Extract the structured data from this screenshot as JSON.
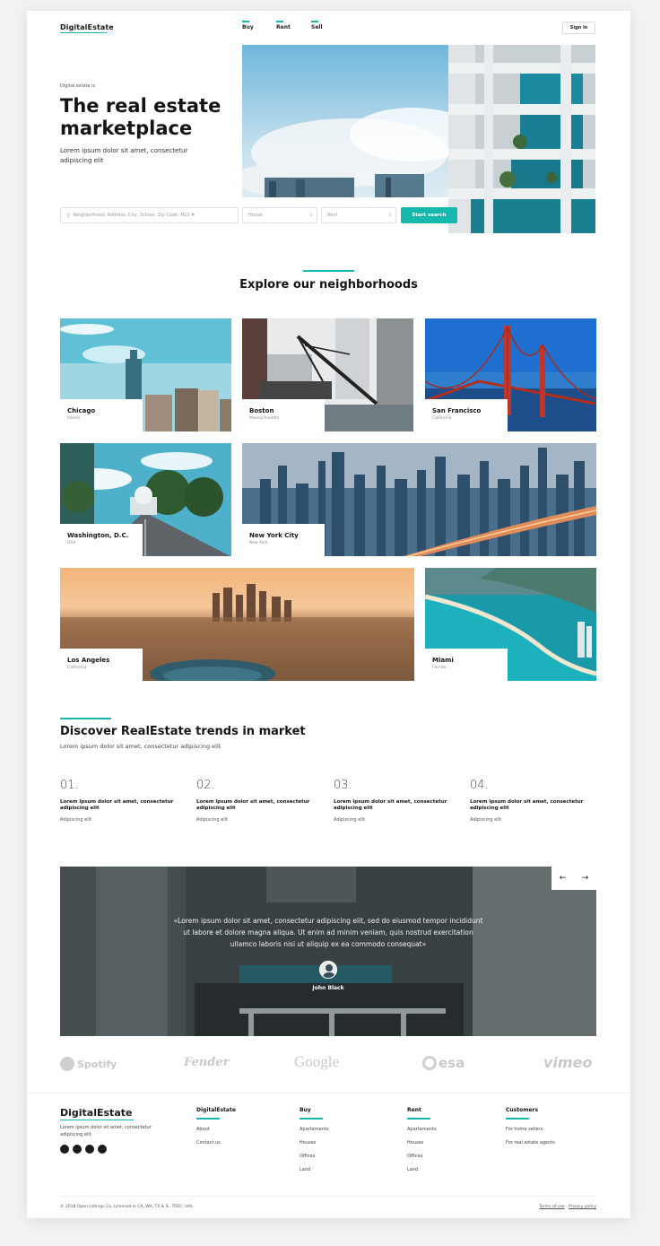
{
  "header": {
    "logo": "DigitalEstate",
    "nav": [
      "Buy",
      "Rent",
      "Sell"
    ],
    "signin": "Sign in"
  },
  "hero": {
    "eyebrow": "Digital estate is",
    "title_line1": "The real estate",
    "title_line2": "marketplace",
    "subtitle_line1": "Lorem ipsum dolor sit amet, consectetur",
    "subtitle_line2": "adipiscing elit"
  },
  "search": {
    "placeholder": "Neighborhood, Address, City, School, Zip Code, MLS #",
    "type_value": "House",
    "mode_value": "Rent",
    "button": "Start search"
  },
  "neighborhoods": {
    "title": "Explore our neighborhoods",
    "cities": [
      {
        "name": "Chicago",
        "state": "Illinois"
      },
      {
        "name": "Boston",
        "state": "Massachusetts"
      },
      {
        "name": "San Francisco",
        "state": "California"
      },
      {
        "name": "Washington, D.C.",
        "state": "USA"
      },
      {
        "name": "New York City",
        "state": "New York"
      },
      {
        "name": "Los Angeles",
        "state": "California"
      },
      {
        "name": "Miami",
        "state": "Florida"
      }
    ]
  },
  "trends": {
    "title": "Discover RealEstate trends in market",
    "subtitle": "Lorem ipsum dolor sit amet, consectetur adipiscing elit",
    "items": [
      {
        "num": "01.",
        "line1": "Lorem ipsum dolor sit amet, consectetur",
        "line2": "adipiscing elit",
        "note": "Adipiscing elit"
      },
      {
        "num": "02.",
        "line1": "Lorem ipsum dolor sit amet, consectetur",
        "line2": "adipiscing elit",
        "note": "Adipiscing elit"
      },
      {
        "num": "03.",
        "line1": "Lorem ipsum dolor sit amet, consectetur",
        "line2": "adipiscing elit",
        "note": "Adipiscing elit"
      },
      {
        "num": "04.",
        "line1": "Lorem ipsum dolor sit amet, consectetur",
        "line2": "adipiscing elit",
        "note": "Adipiscing elit"
      }
    ]
  },
  "testimonial": {
    "line1": "«Lorem ipsum dolor sit amet, consectetur adipiscing elit, sed do eiusmod tempor incididunt",
    "line2": "ut labore et dolore magna aliqua. Ut enim ad minim veniam, quis nostrud exercitation",
    "line3": "ullamco laboris nisi ut aliquip ex ea commodo consequat»",
    "author": "John Black",
    "prev": "←",
    "next": "→"
  },
  "brands": [
    "Spotify",
    "Fender",
    "Google",
    "esa",
    "vimeo"
  ],
  "footer": {
    "logo": "DigitalEstate",
    "about_line1": "Lorem ipsum dolor sit amet, consectetur",
    "about_line2": "adipiscing elit",
    "columns": [
      {
        "title": "DigitalEstate",
        "links": [
          "About",
          "Contact us"
        ]
      },
      {
        "title": "Buy",
        "links": [
          "Apartaments",
          "Houses",
          "Offices",
          "Land"
        ]
      },
      {
        "title": "Rent",
        "links": [
          "Apartaments",
          "Houses",
          "Offices",
          "Land"
        ]
      },
      {
        "title": "Customers",
        "links": [
          "For home sellers",
          "For real estate agents"
        ]
      }
    ],
    "copyright": "© 2018 Open Listings Co. Licensed in CA, WA, TX & IL. TREC: Info",
    "terms": "Terms of use",
    "sep": "·",
    "privacy": "Privacy policy"
  },
  "colors": {
    "accent": "#15b7b1",
    "button": "#16b8ad",
    "text": "#151515"
  }
}
